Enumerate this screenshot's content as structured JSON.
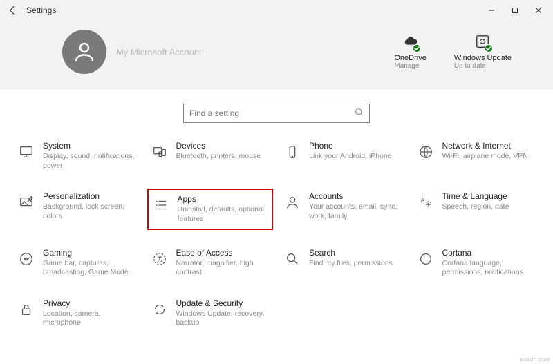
{
  "window": {
    "title": "Settings"
  },
  "account": {
    "label": "My Microsoft Account"
  },
  "status": {
    "onedrive": {
      "title": "OneDrive",
      "sub": "Manage"
    },
    "update": {
      "title": "Windows Update",
      "sub": "Up to date"
    }
  },
  "search": {
    "placeholder": "Find a setting"
  },
  "tiles": {
    "system": {
      "title": "System",
      "desc": "Display, sound, notifications, power"
    },
    "devices": {
      "title": "Devices",
      "desc": "Bluetooth, printers, mouse"
    },
    "phone": {
      "title": "Phone",
      "desc": "Link your Android, iPhone"
    },
    "network": {
      "title": "Network & Internet",
      "desc": "Wi-Fi, airplane mode, VPN"
    },
    "personal": {
      "title": "Personalization",
      "desc": "Background, lock screen, colors"
    },
    "apps": {
      "title": "Apps",
      "desc": "Uninstall, defaults, optional features"
    },
    "accounts": {
      "title": "Accounts",
      "desc": "Your accounts, email, sync, work, family"
    },
    "time": {
      "title": "Time & Language",
      "desc": "Speech, region, date"
    },
    "gaming": {
      "title": "Gaming",
      "desc": "Game bar, captures, broadcasting, Game Mode"
    },
    "ease": {
      "title": "Ease of Access",
      "desc": "Narrator, magnifier, high contrast"
    },
    "searchcat": {
      "title": "Search",
      "desc": "Find my files, permissions"
    },
    "cortana": {
      "title": "Cortana",
      "desc": "Cortana language, permissions, notifications"
    },
    "privacy": {
      "title": "Privacy",
      "desc": "Location, camera, microphone"
    },
    "updatesec": {
      "title": "Update & Security",
      "desc": "Windows Update, recovery, backup"
    }
  },
  "watermark": "wsxdn.com"
}
